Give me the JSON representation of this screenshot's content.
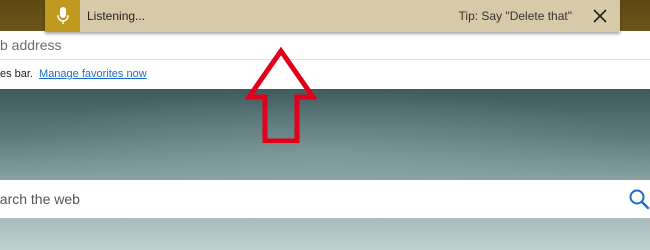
{
  "voice_banner": {
    "status": "Listening...",
    "tip": "Tip: Say \"Delete that\"",
    "accent_color": "#bf9a1f",
    "background_color": "#d6caa8",
    "icons": {
      "mic": "microphone-icon",
      "close": "close-icon"
    }
  },
  "address_bar": {
    "placeholder": "b address"
  },
  "favorites_bar": {
    "text": "es bar.",
    "link": "Manage favorites now"
  },
  "search": {
    "placeholder": "earch the web",
    "icon": "search-icon"
  },
  "annotation": {
    "arrow_color": "#e0001a",
    "arrow_direction": "up"
  }
}
